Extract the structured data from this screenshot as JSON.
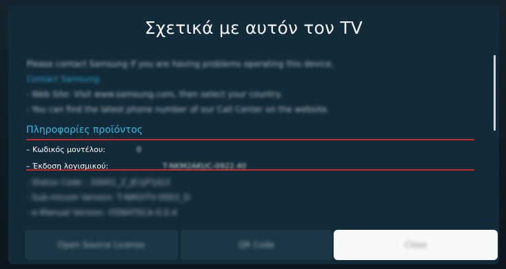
{
  "dialog": {
    "title": "Σχετικά με αυτόν τον TV"
  },
  "content": {
    "intro": "Please contact Samsung if you are having problems operating this device.",
    "contact_heading": "Contact Samsung",
    "contact_lines": [
      "- Web Site: Visit www.samsung.com, then select your country.",
      "- You can find the latest phone number of our Call Center on the website."
    ],
    "product_info_heading": "Πληροφορίες προϊόντος",
    "fields": [
      {
        "label": "Κωδικός μοντέλου:",
        "value": "0"
      },
      {
        "label": "Έκδοση λογισμικού:",
        "value": "T-NKM2AKUC-0922.40"
      }
    ],
    "extra_lines": [
      "Status Code : 20001_Z_JE1JP1JG3",
      "Sub-micom Version: T-NM2ITV-0003_D",
      "e-Manual Version: OSNATSCA-0.0.4"
    ]
  },
  "buttons": {
    "open_source": "Open Source License",
    "qr_code": "QR Code",
    "close": "Close"
  },
  "colors": {
    "dialog_bg": "#132a38",
    "accent_link": "#33b6e6",
    "highlight_border": "#c4282c",
    "close_button_bg": "#f7f8f8"
  }
}
